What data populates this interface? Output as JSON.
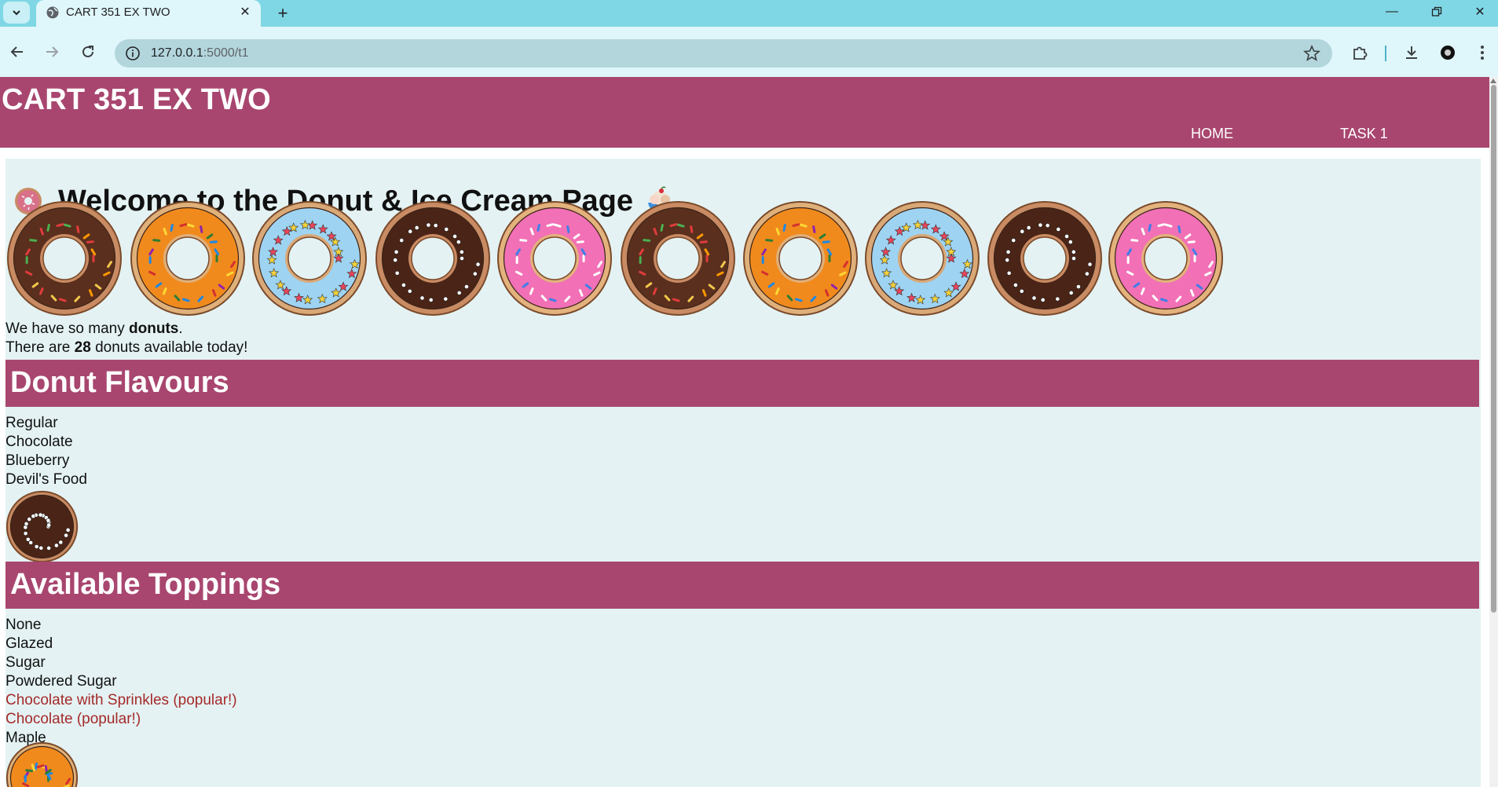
{
  "browser": {
    "tab_title": "CART 351 EX TWO",
    "url_host": "127.0.0.1",
    "url_path": ":5000/t1"
  },
  "site": {
    "title": "CART 351 EX TWO",
    "nav": [
      "HOME",
      "TASK 1"
    ]
  },
  "welcome": {
    "heading": "Welcome to the Donut & Ice Cream Page"
  },
  "donut_gallery": [
    "chocolate",
    "orange-sprinkles",
    "blue-stars",
    "dark-chocolate-dots",
    "pink-sprinkles",
    "chocolate",
    "orange-sprinkles",
    "blue-stars",
    "dark-chocolate-dots",
    "pink-sprinkles"
  ],
  "intro": {
    "line1_prefix": "We have so many ",
    "line1_bold": "donuts",
    "line1_suffix": ".",
    "line2_prefix": "There are ",
    "line2_count": "28",
    "line2_suffix": " donuts available today!"
  },
  "flavours": {
    "heading": "Donut Flavours",
    "items": [
      "Regular",
      "Chocolate",
      "Blueberry",
      "Devil's Food"
    ],
    "image": "dark-chocolate-dots"
  },
  "toppings": {
    "heading": "Available Toppings",
    "items": [
      {
        "label": "None",
        "popular": false
      },
      {
        "label": "Glazed",
        "popular": false
      },
      {
        "label": "Sugar",
        "popular": false
      },
      {
        "label": "Powdered Sugar",
        "popular": false
      },
      {
        "label": "Chocolate with Sprinkles (popular!)",
        "popular": true
      },
      {
        "label": "Chocolate (popular!)",
        "popular": true
      },
      {
        "label": "Maple",
        "popular": false
      }
    ],
    "image": "orange-sprinkles"
  },
  "colors": {
    "header": "#a8466f",
    "content_bg": "#e4f2f3",
    "popular_text": "#a52a2a"
  }
}
